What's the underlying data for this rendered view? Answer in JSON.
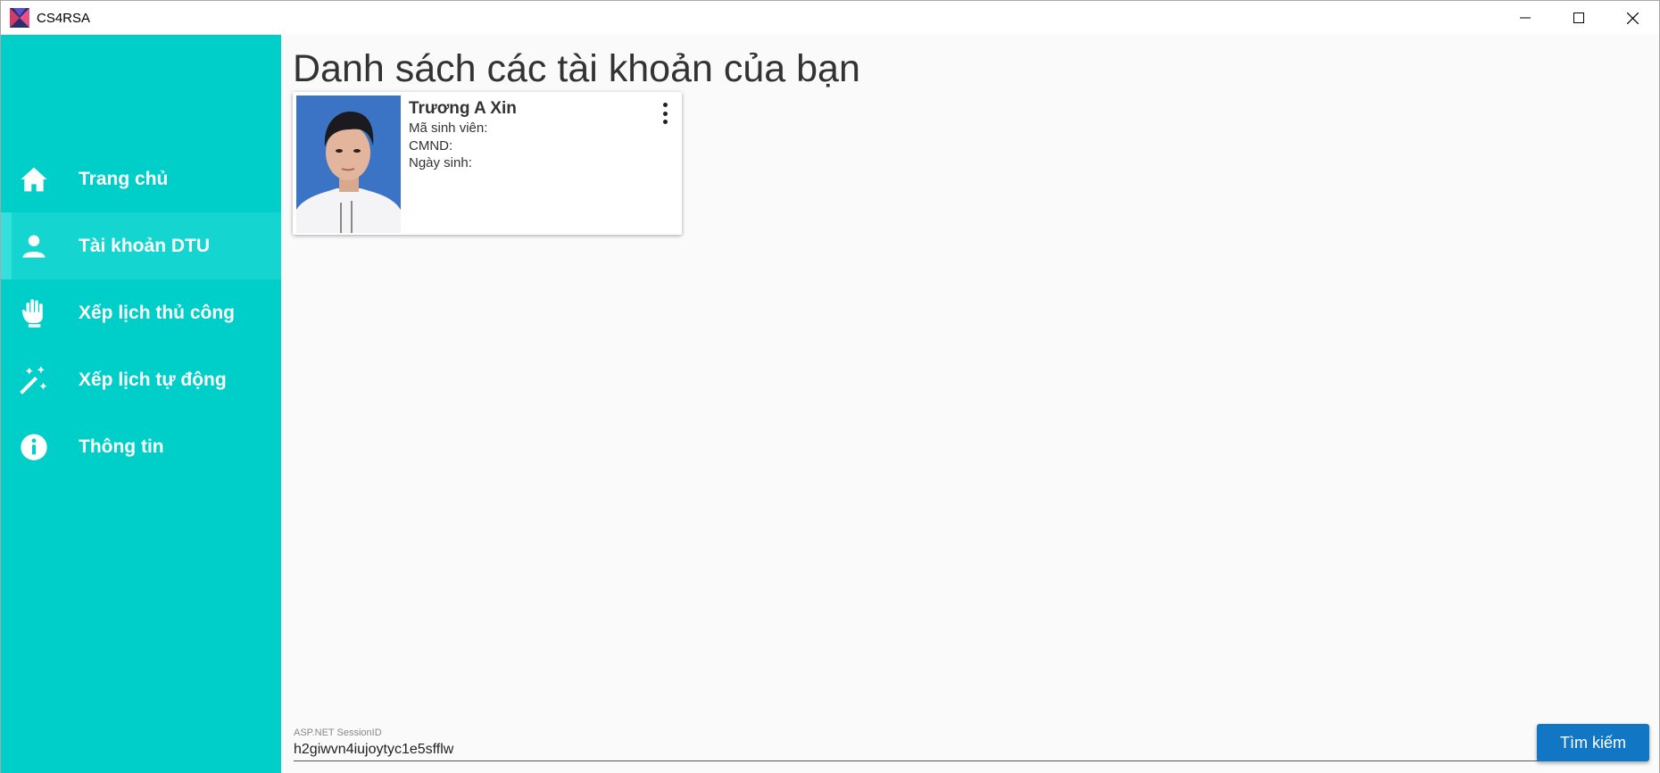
{
  "window": {
    "title": "CS4RSA",
    "controls": [
      "minimize-icon",
      "maximize-icon",
      "close-icon"
    ]
  },
  "sidebar": {
    "items": [
      {
        "label": "Trang chủ",
        "icon": "home-icon",
        "active": false
      },
      {
        "label": "Tài khoản DTU",
        "icon": "account-icon",
        "active": true
      },
      {
        "label": "Xếp lịch thủ công",
        "icon": "hand-icon",
        "active": false
      },
      {
        "label": "Xếp lịch tự động",
        "icon": "magic-wand-icon",
        "active": false
      },
      {
        "label": "Thông tin",
        "icon": "info-icon",
        "active": false
      }
    ]
  },
  "main": {
    "title": "Danh sách các tài khoản của bạn",
    "accounts": [
      {
        "name": "Trương A Xin",
        "student_id_label": "Mã sinh viên:",
        "id_card_label": "CMND:",
        "birthdate_label": "Ngày sinh:"
      }
    ],
    "session": {
      "label": "ASP.NET SessionID",
      "value": "h2giwvn4iujoytyc1e5sfflw"
    },
    "search_button": "Tìm kiếm"
  },
  "colors": {
    "sidebar": "#00cec9",
    "sidebar_active": "#14d5d0",
    "button": "#1177c4",
    "background": "#fafafa"
  }
}
